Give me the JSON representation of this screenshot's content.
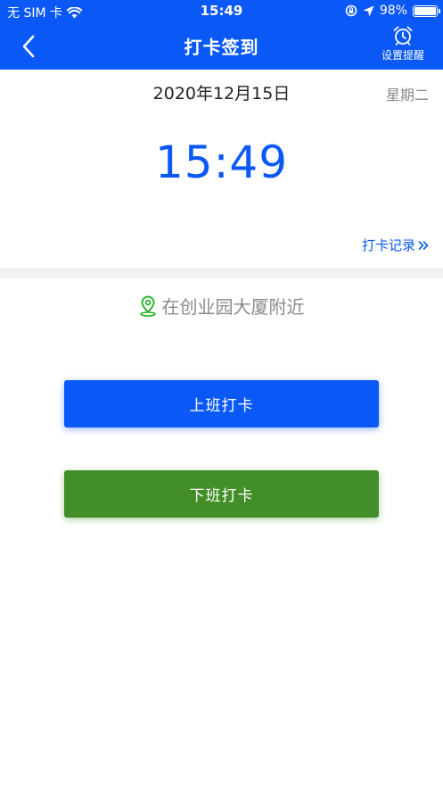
{
  "status_bar": {
    "carrier": "无 SIM 卡",
    "time": "15:49",
    "battery_percent": "98%",
    "battery_level": 0.98
  },
  "nav": {
    "title": "打卡签到",
    "alarm_label": "设置提醒"
  },
  "date": {
    "full_date": "2020年12月15日",
    "weekday": "星期二"
  },
  "clock": "15:49",
  "records_link": "打卡记录",
  "location": {
    "text": "在创业园大厦附近"
  },
  "buttons": {
    "check_in": "上班打卡",
    "check_out": "下班打卡"
  },
  "colors": {
    "primary": "#0a59f6",
    "check_out_green": "#428f29",
    "location_pin": "#2bb52b",
    "muted_text": "#8a8a8a"
  }
}
